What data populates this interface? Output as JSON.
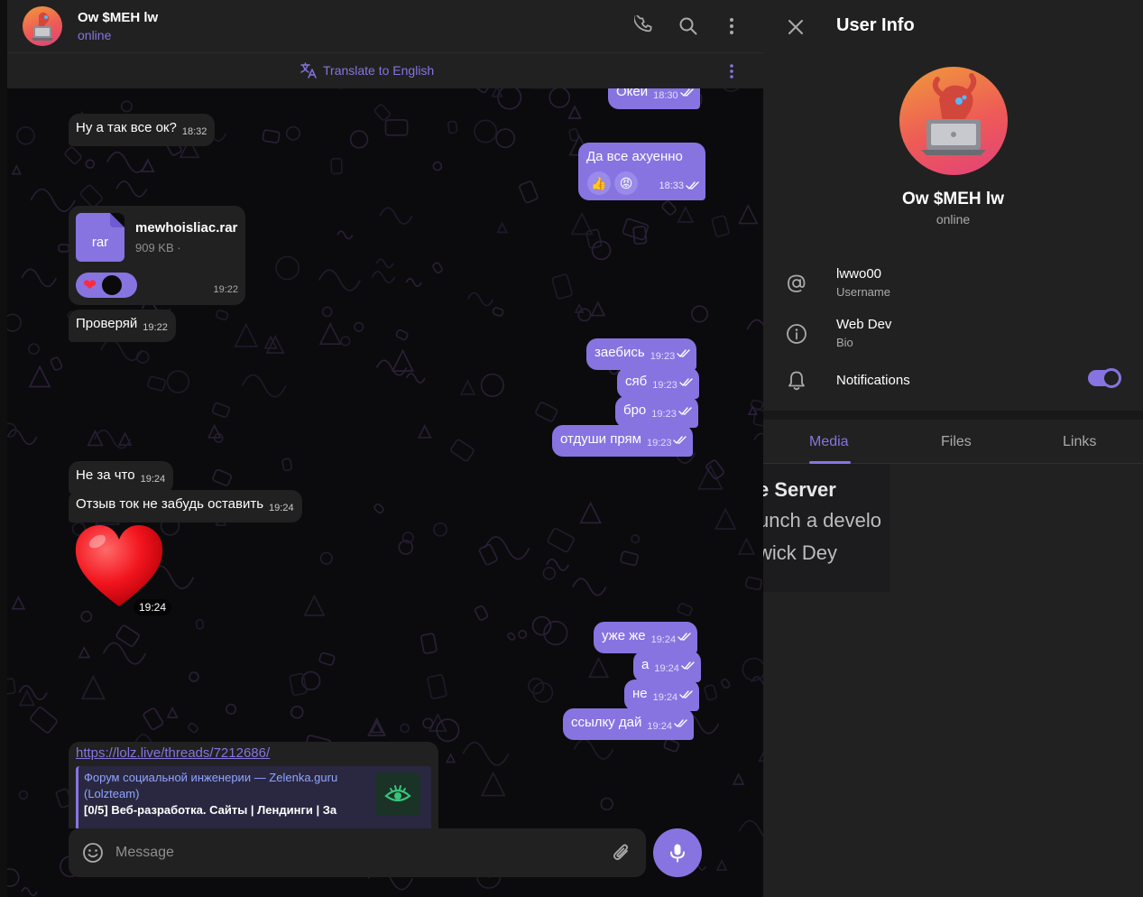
{
  "chat": {
    "header": {
      "name": "Ow $MEH lw",
      "status": "online"
    },
    "translate_label": "Translate to English",
    "composer_placeholder": "Message",
    "messages": [
      {
        "id": "m0",
        "dir": "out",
        "text": "Окей",
        "time": "18:30"
      },
      {
        "id": "m1",
        "dir": "in",
        "text": "Ну а так все ок?",
        "time": "18:32"
      },
      {
        "id": "m2",
        "dir": "out",
        "text": "Да все ахуенно",
        "time": "18:33",
        "reactions": [
          "👍",
          "😡"
        ]
      },
      {
        "id": "m3",
        "dir": "in",
        "type": "file",
        "file_name": "mewhoisliac.rar",
        "file_ext": "rar",
        "file_size": "909 KB ·",
        "time": "19:22",
        "reactions": [
          "❤",
          "●"
        ]
      },
      {
        "id": "m4",
        "dir": "in",
        "text": "Проверяй",
        "time": "19:22"
      },
      {
        "id": "m5",
        "dir": "out",
        "text": "заебись",
        "time": "19:23"
      },
      {
        "id": "m6",
        "dir": "out",
        "text": "сяб",
        "time": "19:23"
      },
      {
        "id": "m7",
        "dir": "out",
        "text": "бро",
        "time": "19:23"
      },
      {
        "id": "m8",
        "dir": "out",
        "text": "отдуши прям",
        "time": "19:23"
      },
      {
        "id": "m9",
        "dir": "in",
        "text": "Не за что",
        "time": "19:24"
      },
      {
        "id": "m10",
        "dir": "in",
        "text": "Отзыв ток не забудь оставить",
        "time": "19:24"
      },
      {
        "id": "m11",
        "dir": "in",
        "type": "sticker",
        "time": "19:24"
      },
      {
        "id": "m12",
        "dir": "out",
        "text": "уже же",
        "time": "19:24"
      },
      {
        "id": "m13",
        "dir": "out",
        "text": "а",
        "time": "19:24"
      },
      {
        "id": "m14",
        "dir": "out",
        "text": "не",
        "time": "19:24"
      },
      {
        "id": "m15",
        "dir": "out",
        "text": "ссылку дай",
        "time": "19:24"
      },
      {
        "id": "m16",
        "dir": "in",
        "type": "link",
        "url": "https://lolz.live/threads/7212686/",
        "site": "Форум социальной инженерии — Zelenka.guru (Lolzteam)",
        "desc": "[0/5] Веб-разработка. Сайты | Лендинги | За"
      }
    ]
  },
  "info": {
    "title": "User Info",
    "name": "Ow $MEH lw",
    "status": "online",
    "username": "lwwo00",
    "username_label": "Username",
    "bio": "Web Dev",
    "bio_label": "Bio",
    "notifications_label": "Notifications",
    "notifications_on": true,
    "tabs": [
      "Media",
      "Files",
      "Links"
    ],
    "active_tab": "Media",
    "media_preview_lines": [
      "e Server",
      "unch a develo",
      "wick Dey"
    ]
  },
  "colors": {
    "accent": "#8774e1",
    "panel": "#212121",
    "background": "#0b0b0d",
    "outgoing_bubble": "#8774e1",
    "incoming_bubble": "#212121"
  },
  "icons": [
    "phone-icon",
    "search-icon",
    "more-vertical-icon",
    "translate-icon",
    "close-icon",
    "at-icon",
    "info-icon",
    "bell-icon",
    "emoji-icon",
    "paperclip-icon",
    "microphone-icon",
    "double-check-icon"
  ]
}
